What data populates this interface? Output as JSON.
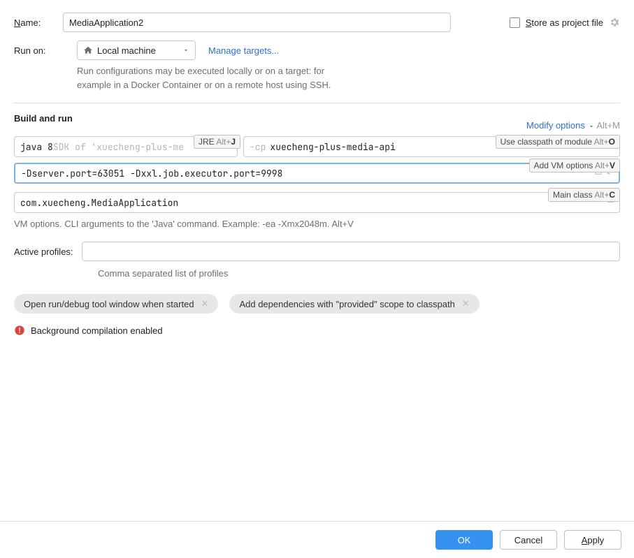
{
  "name": {
    "label_prefix": "N",
    "label_rest": "ame:",
    "value": "MediaApplication2"
  },
  "store": {
    "label_prefix": "S",
    "label_rest": "tore as project file"
  },
  "runon": {
    "label": "Run on:",
    "selected": "Local machine",
    "manage_link": "Manage targets...",
    "note_line1": "Run configurations may be executed locally or on a target: for",
    "note_line2": "example in a Docker Container or on a remote host using SSH."
  },
  "section_title": "Build and run",
  "modify_options": {
    "label": "Modify options",
    "shortcut": "Alt+M"
  },
  "hints": {
    "jre": {
      "text": "JRE ",
      "shortcut_pre": "Alt+",
      "shortcut_key": "J"
    },
    "cp": {
      "text": "Use classpath of module ",
      "shortcut_pre": "Alt+",
      "shortcut_key": "O"
    },
    "vm": {
      "text": "Add VM options ",
      "shortcut_pre": "Alt+",
      "shortcut_key": "V"
    },
    "main": {
      "text": "Main class ",
      "shortcut_pre": "Alt+",
      "shortcut_key": "C"
    }
  },
  "jdk": {
    "prefix": "java 8 ",
    "dim": "SDK of 'xuecheng-plus-me"
  },
  "cp": {
    "prefix": "-cp ",
    "value": "xuecheng-plus-media-api"
  },
  "vm": {
    "value": "-Dserver.port=63051 -Dxxl.job.executor.port=9998"
  },
  "main": {
    "value": "com.xuecheng.MediaApplication"
  },
  "vm_help": "VM options. CLI arguments to the 'Java' command. Example: -ea -Xmx2048m. Alt+V",
  "profiles": {
    "label": "Active profiles:",
    "value": "",
    "help": "Comma separated list of profiles"
  },
  "chips": [
    "Open run/debug tool window when started",
    "Add dependencies with \"provided\" scope to classpath"
  ],
  "warning": "Background compilation enabled",
  "buttons": {
    "ok": "OK",
    "cancel": "Cancel",
    "apply_prefix": "A",
    "apply_rest": "pply"
  }
}
